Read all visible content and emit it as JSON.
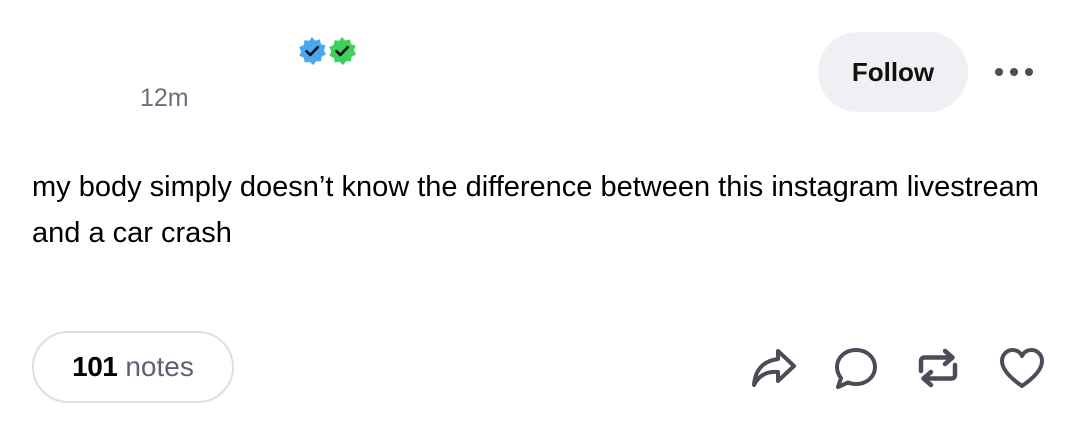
{
  "post": {
    "timestamp": "12m",
    "body": "my body simply doesn’t know the difference between this instagram livestream and a car crash",
    "badges": [
      {
        "name": "blue-verified-badge",
        "color": "#4aa8f0"
      },
      {
        "name": "green-verified-badge",
        "color": "#3ecf5e"
      }
    ]
  },
  "header": {
    "follow_label": "Follow",
    "more_icon": "more-horizontal-icon"
  },
  "footer": {
    "notes_count": "101",
    "notes_label": "notes",
    "actions": [
      {
        "name": "share-icon"
      },
      {
        "name": "reply-icon"
      },
      {
        "name": "reblog-icon"
      },
      {
        "name": "like-heart-icon"
      }
    ]
  },
  "colors": {
    "follow_bg": "#eff0f3",
    "icon": "#4a4d58",
    "muted_text": "#6b6f7d",
    "pill_border": "#dedfe3"
  }
}
